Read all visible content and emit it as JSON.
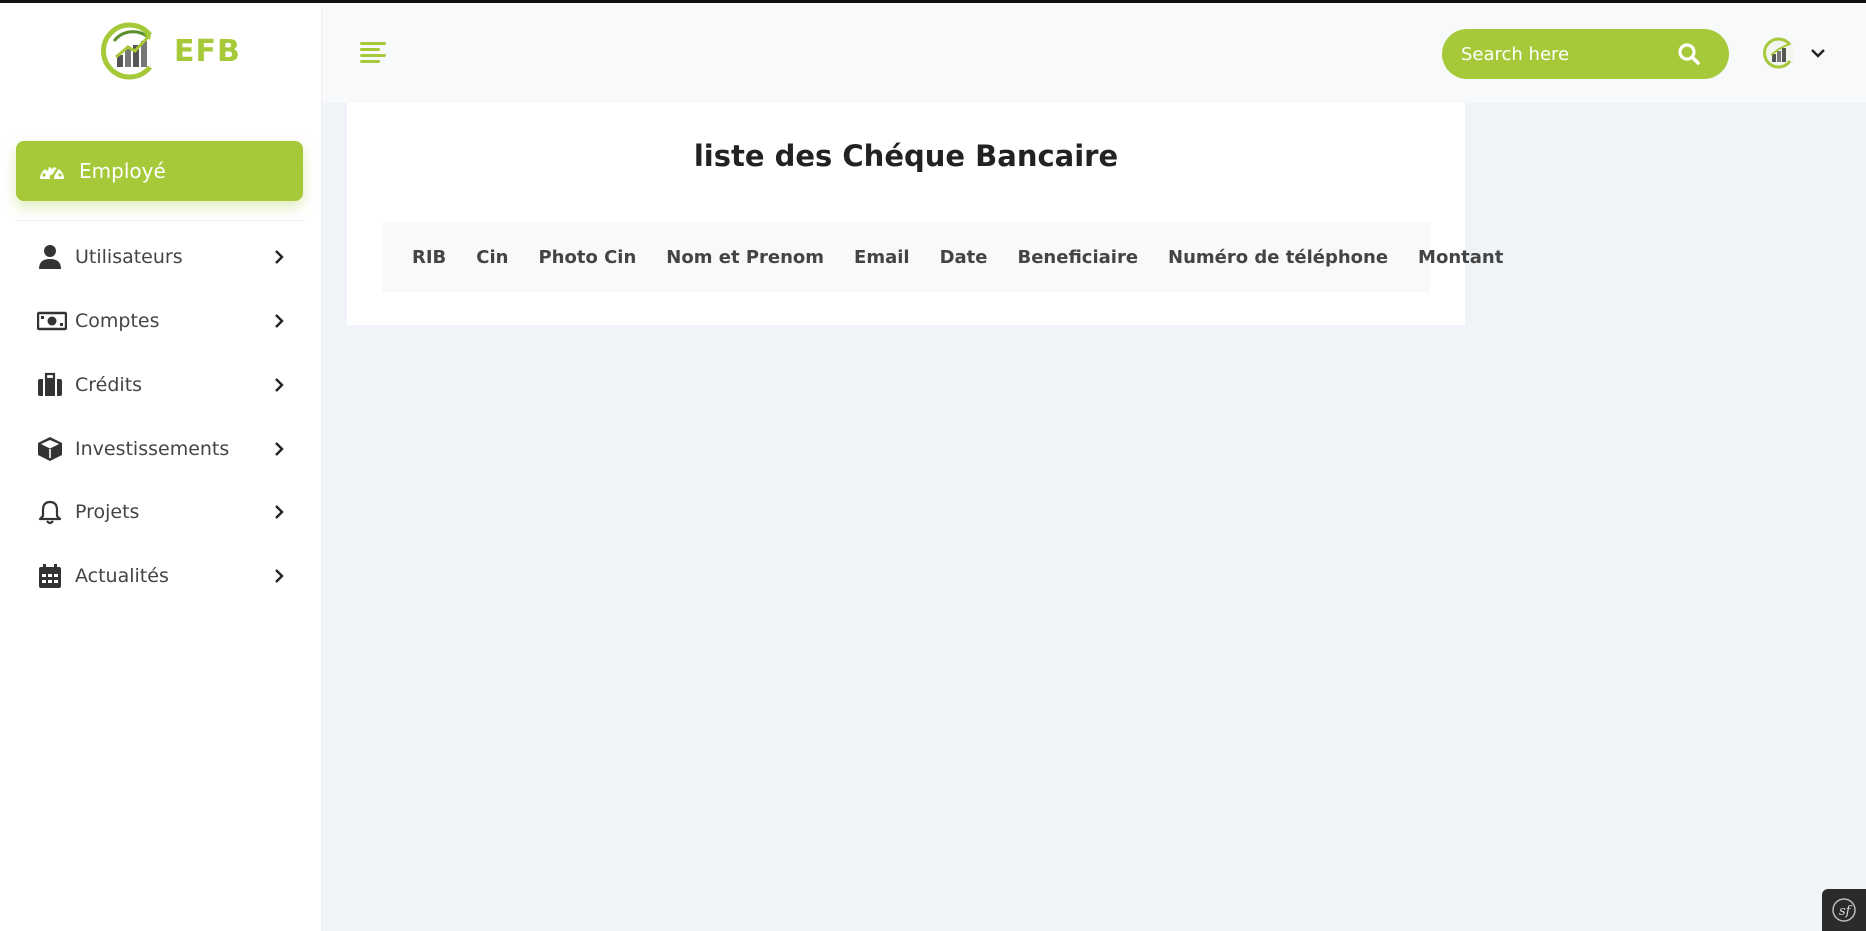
{
  "app": {
    "logo_text": "EFB"
  },
  "sidebar": {
    "active_item": {
      "label": "Employé",
      "icon": "dashboard-gauge-icon"
    },
    "items": [
      {
        "label": "Utilisateurs",
        "icon": "user-icon"
      },
      {
        "label": "Comptes",
        "icon": "money-bill-icon"
      },
      {
        "label": "Crédits",
        "icon": "briefcase-icon"
      },
      {
        "label": "Investissements",
        "icon": "cube-icon"
      },
      {
        "label": "Projets",
        "icon": "bell-icon"
      },
      {
        "label": "Actualités",
        "icon": "calendar-icon"
      }
    ]
  },
  "header": {
    "menu_icon": "hamburger-icon",
    "search": {
      "placeholder": "Search here",
      "icon": "search-icon"
    },
    "avatar_icon": "user-avatar-logo",
    "dropdown_icon": "chevron-down-icon"
  },
  "main": {
    "title": "liste des Chéque Bancaire",
    "table": {
      "columns": [
        "RIB",
        "Cin",
        "Photo Cin",
        "Nom et Prenom",
        "Email",
        "Date",
        "Beneficiaire",
        "Numéro de téléphone",
        "Montant"
      ],
      "rows": []
    }
  },
  "colors": {
    "accent": "#a6c939",
    "sidebar_bg": "#ffffff",
    "page_bg": "#f0f4f8",
    "text": "#444444"
  },
  "debug_badge": {
    "icon": "symfony-icon"
  }
}
